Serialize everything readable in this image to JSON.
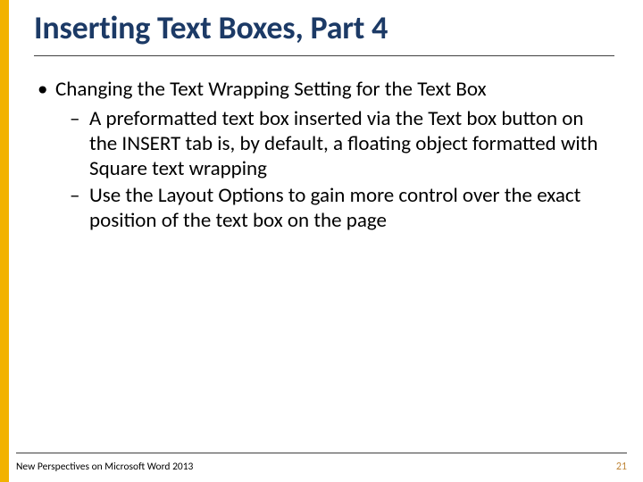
{
  "accent_color": "#f2b200",
  "title": "Inserting Text Boxes, Part 4",
  "bullets": {
    "level1": "Changing the Text Wrapping Setting for the Text Box",
    "level2a": "A preformatted text box inserted via the Text box button on the INSERT tab is, by default, a floating object formatted with Square text wrapping",
    "level2b": "Use the Layout Options to gain more control over the exact position of the text box on the page"
  },
  "footer": {
    "left": "New Perspectives on Microsoft Word 2013",
    "page": "21"
  }
}
